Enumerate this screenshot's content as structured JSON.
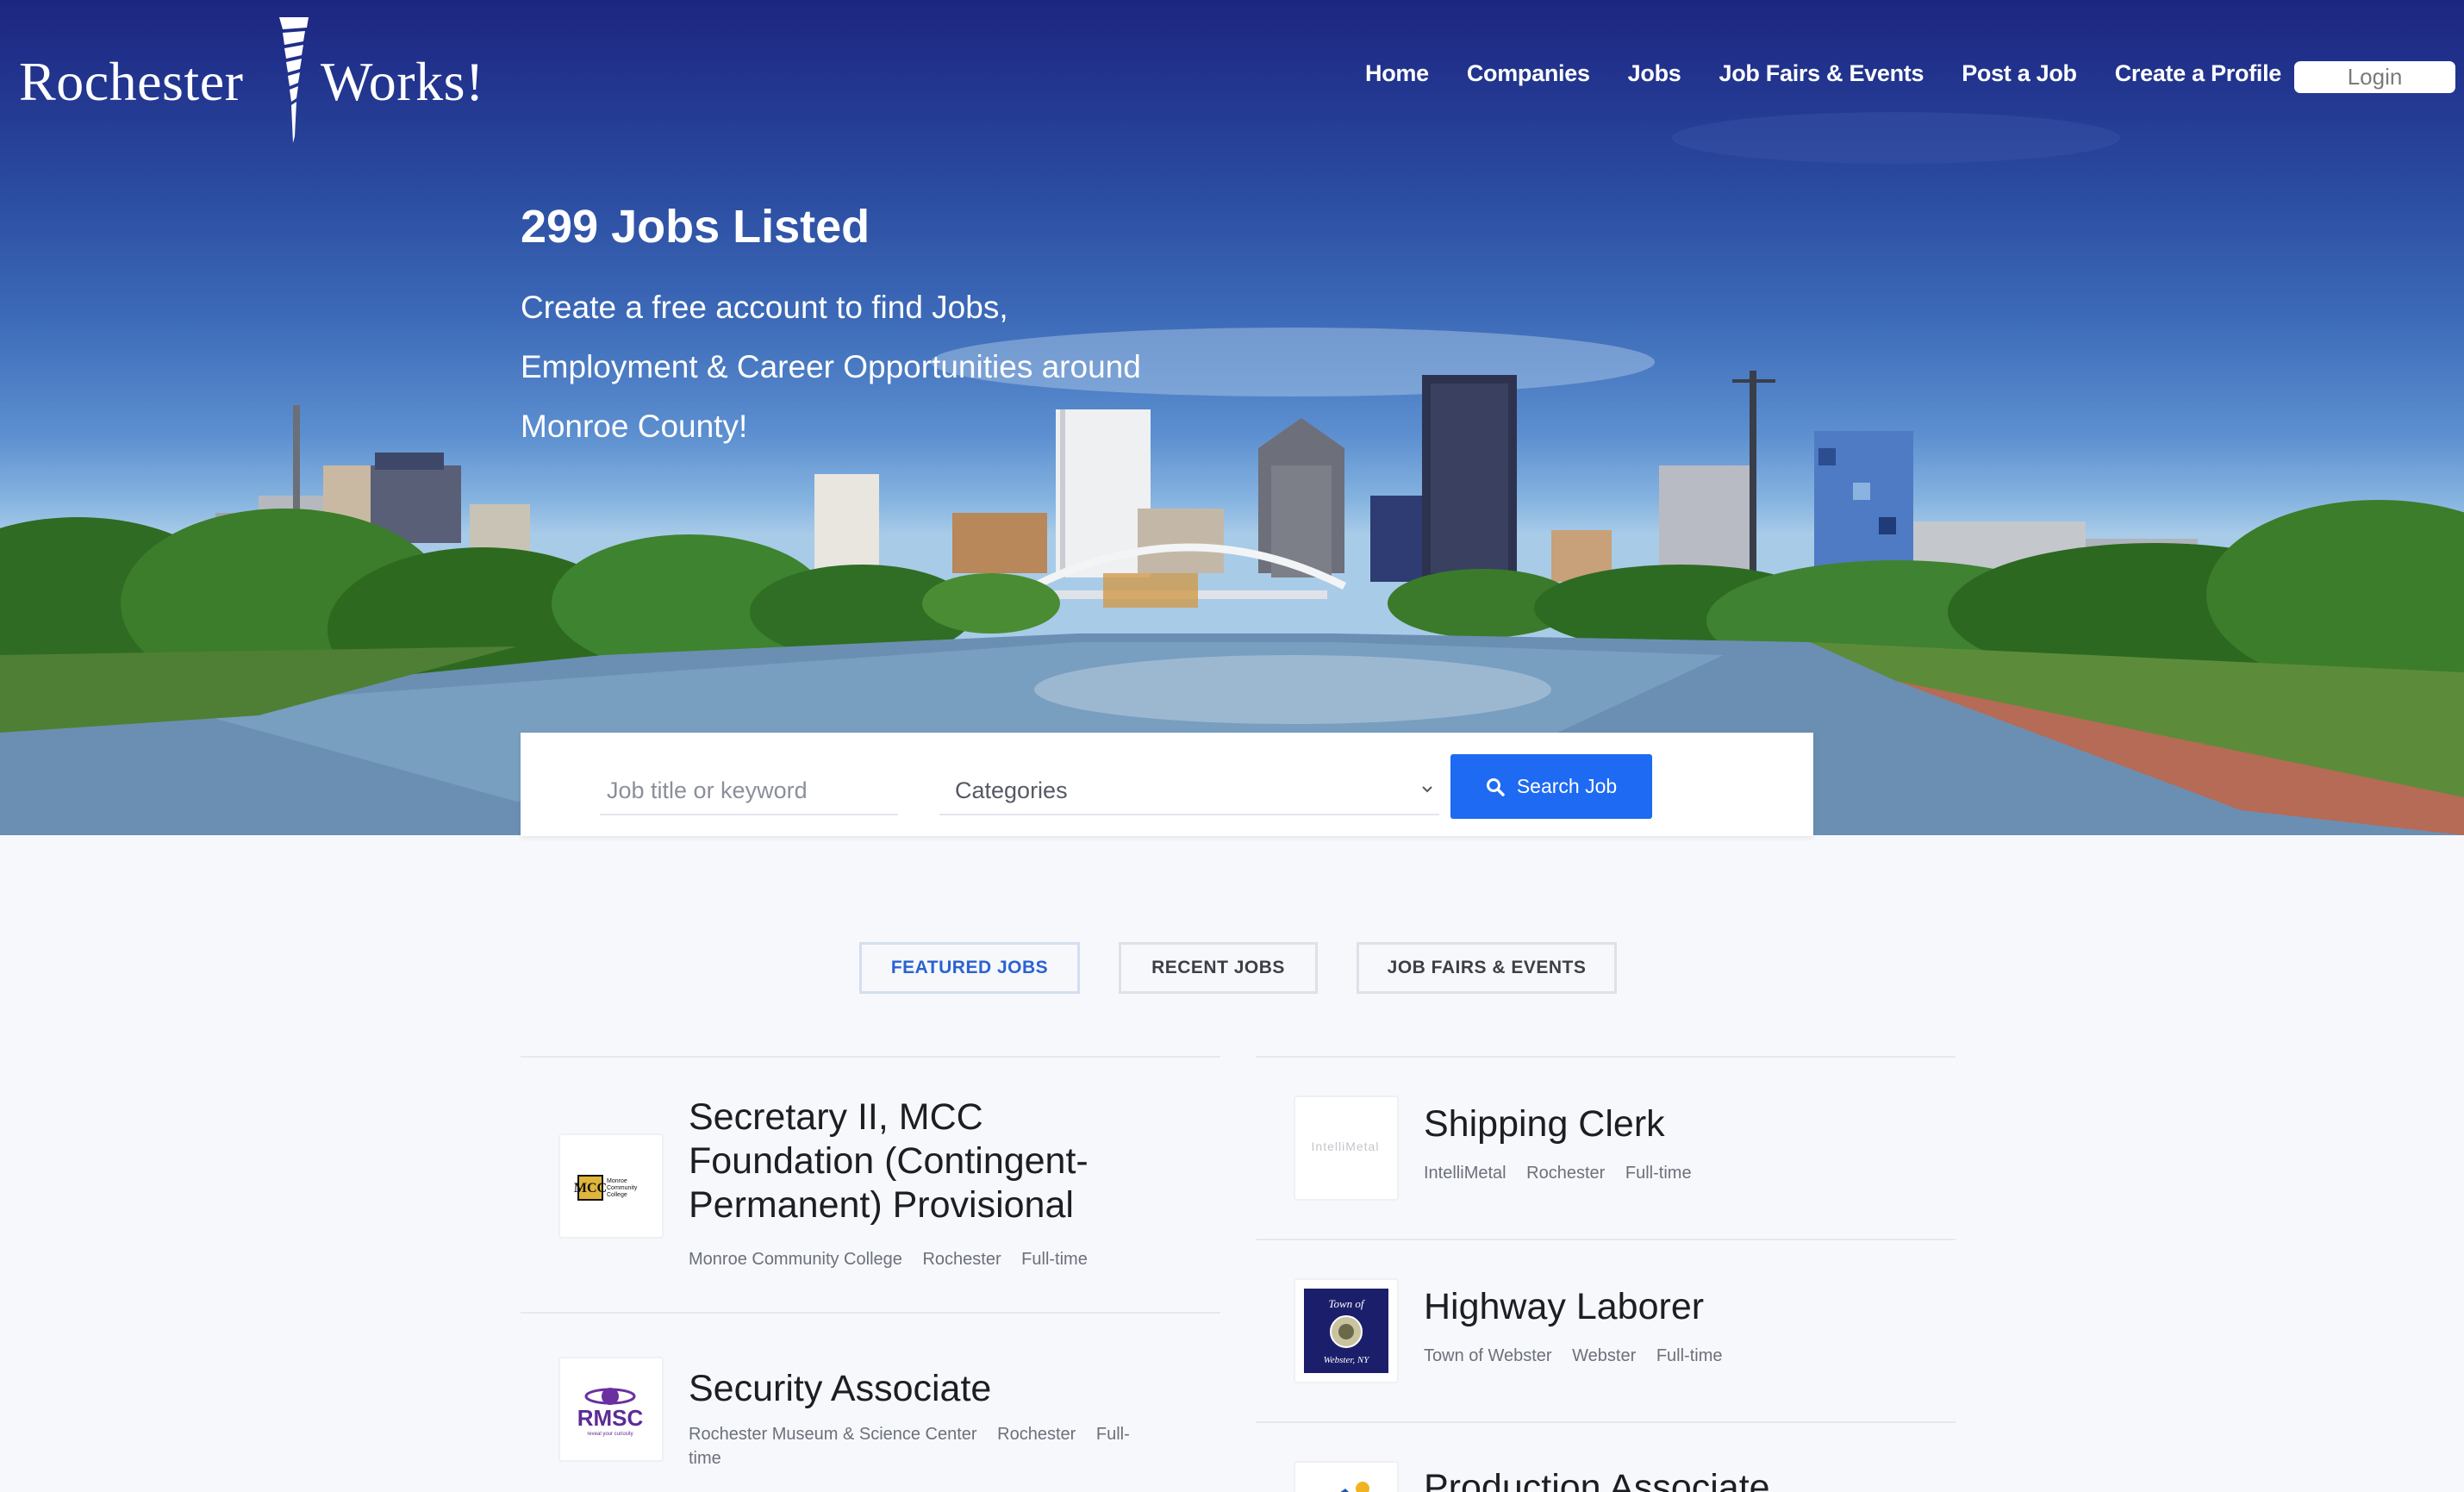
{
  "brand": {
    "left": "Rochester",
    "right": "Works!"
  },
  "nav": {
    "items": [
      "Home",
      "Companies",
      "Jobs",
      "Job Fairs & Events",
      "Post a Job",
      "Create a Profile"
    ],
    "login": "Login"
  },
  "hero": {
    "title": "299 Jobs Listed",
    "subtitle_lines": [
      "Create a free account to find Jobs,",
      "Employment & Career Opportunities around",
      "Monroe County!"
    ]
  },
  "search": {
    "placeholder": "Job title or keyword",
    "category": "Categories",
    "button": "Search Job"
  },
  "tabs": [
    {
      "label": "FEATURED JOBS",
      "active": true
    },
    {
      "label": "RECENT JOBS",
      "active": false
    },
    {
      "label": "JOB FAIRS & EVENTS",
      "active": false
    }
  ],
  "jobs_left": [
    {
      "title_lines": [
        "Secretary II, MCC",
        "Foundation (Contingent-",
        "Permanent) Provisional"
      ],
      "company": "Monroe Community College",
      "location": "Rochester",
      "type": "Full-time",
      "logo_text": {
        "abbr": "MCC",
        "name_lines": [
          "Monroe",
          "Community",
          "College"
        ]
      }
    },
    {
      "title_lines": [
        "Security Associate"
      ],
      "company": "Rochester Museum & Science Center",
      "location": "Rochester",
      "type_lines": [
        "Full-",
        "time"
      ],
      "logo_text": {
        "abbr": "RMSC",
        "tagline": "reveal your curiosity"
      }
    }
  ],
  "jobs_right": [
    {
      "title": "Shipping Clerk",
      "company": "IntelliMetal",
      "location": "Rochester",
      "type": "Full-time",
      "logo_text": {
        "abbr": "IntelliMetal"
      }
    },
    {
      "title": "Highway Laborer",
      "company": "Town of Webster",
      "location": "Webster",
      "type": "Full-time",
      "logo_text": {
        "top": "Town of",
        "bottom": "Webster, NY"
      }
    },
    {
      "title": "Production Associate"
    }
  ],
  "colors": {
    "accent": "#1e6af2",
    "nav_text": "#ffffff",
    "header_bg": "#1c2680",
    "tab_active": "#2a62d1",
    "page_bg": "#f6f8fc"
  }
}
